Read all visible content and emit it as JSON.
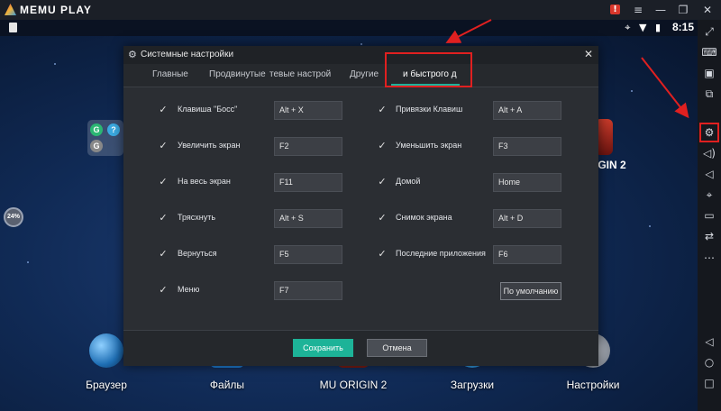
{
  "app": {
    "name": "MEMU PLAY"
  },
  "titlebar": {
    "buttons": [
      "!",
      "≡",
      "—",
      "❐",
      "✕"
    ]
  },
  "statusbar": {
    "icons": "⌖ ▼ ▮",
    "time": "8:15"
  },
  "memory_widget": {
    "value": "24%"
  },
  "dialog": {
    "title": "Системные настройки",
    "tabs": [
      {
        "label": "Главные"
      },
      {
        "label": "Продвинутые"
      },
      {
        "label": "тевые настрой"
      },
      {
        "label": "Другие"
      },
      {
        "label": "и быстрого д"
      }
    ],
    "active_tab": "и быстрого д",
    "hotkeys": [
      {
        "label": "Клавиша \"Босс\"",
        "key": "Alt + X",
        "checked": true
      },
      {
        "label": "Привязки Клавиш",
        "key": "Alt + A",
        "checked": true
      },
      {
        "label": "Увеличить экран",
        "key": "F2",
        "checked": true
      },
      {
        "label": "Уменьшить экран",
        "key": "F3",
        "checked": true
      },
      {
        "label": "На весь экран",
        "key": "F11",
        "checked": true
      },
      {
        "label": "Домой",
        "key": "Home",
        "checked": true
      },
      {
        "label": "Трясхнуть",
        "key": "Alt + S",
        "checked": true
      },
      {
        "label": "Снимок экрана",
        "key": "Alt + D",
        "checked": true
      },
      {
        "label": "Вернуться",
        "key": "F5",
        "checked": true
      },
      {
        "label": "Последние приложения",
        "key": "F6",
        "checked": true
      },
      {
        "label": "Меню",
        "key": "F7",
        "checked": true
      }
    ],
    "defaults_button": "По умолчанию",
    "save_button": "Сохранить",
    "cancel_button": "Отмена"
  },
  "desktop": {
    "folder_badges": [
      "G",
      "?",
      "G"
    ],
    "apps": [
      {
        "label": "Браузер"
      },
      {
        "label": "Файлы"
      },
      {
        "label": "MU ORIGIN 2"
      },
      {
        "label": "Загрузки"
      },
      {
        "label": "Настройки"
      }
    ],
    "mu_right_label": "IGIN 2"
  },
  "sidebar": {
    "items": [
      {
        "icon": "fullscreen-icon",
        "glyph": "⤢"
      },
      {
        "icon": "keyboard-icon",
        "glyph": "⌨"
      },
      {
        "icon": "apk-icon",
        "glyph": "▣"
      },
      {
        "icon": "multi-window-icon",
        "glyph": "⧉"
      },
      {
        "icon": "settings-gear-icon",
        "glyph": "⚙"
      },
      {
        "icon": "volume-up-icon",
        "glyph": "◁)"
      },
      {
        "icon": "volume-down-icon",
        "glyph": "◁"
      },
      {
        "icon": "location-icon",
        "glyph": "⌖"
      },
      {
        "icon": "folder-icon",
        "glyph": "▭"
      },
      {
        "icon": "rotate-icon",
        "glyph": "⇄"
      },
      {
        "icon": "more-icon",
        "glyph": "…"
      }
    ],
    "nav": [
      {
        "icon": "back-icon",
        "glyph": "◁"
      },
      {
        "icon": "home-icon",
        "glyph": "○"
      },
      {
        "icon": "recent-apps-icon",
        "glyph": "□"
      }
    ]
  },
  "colors": {
    "accent": "#1db398",
    "annotation": "#e02020"
  }
}
